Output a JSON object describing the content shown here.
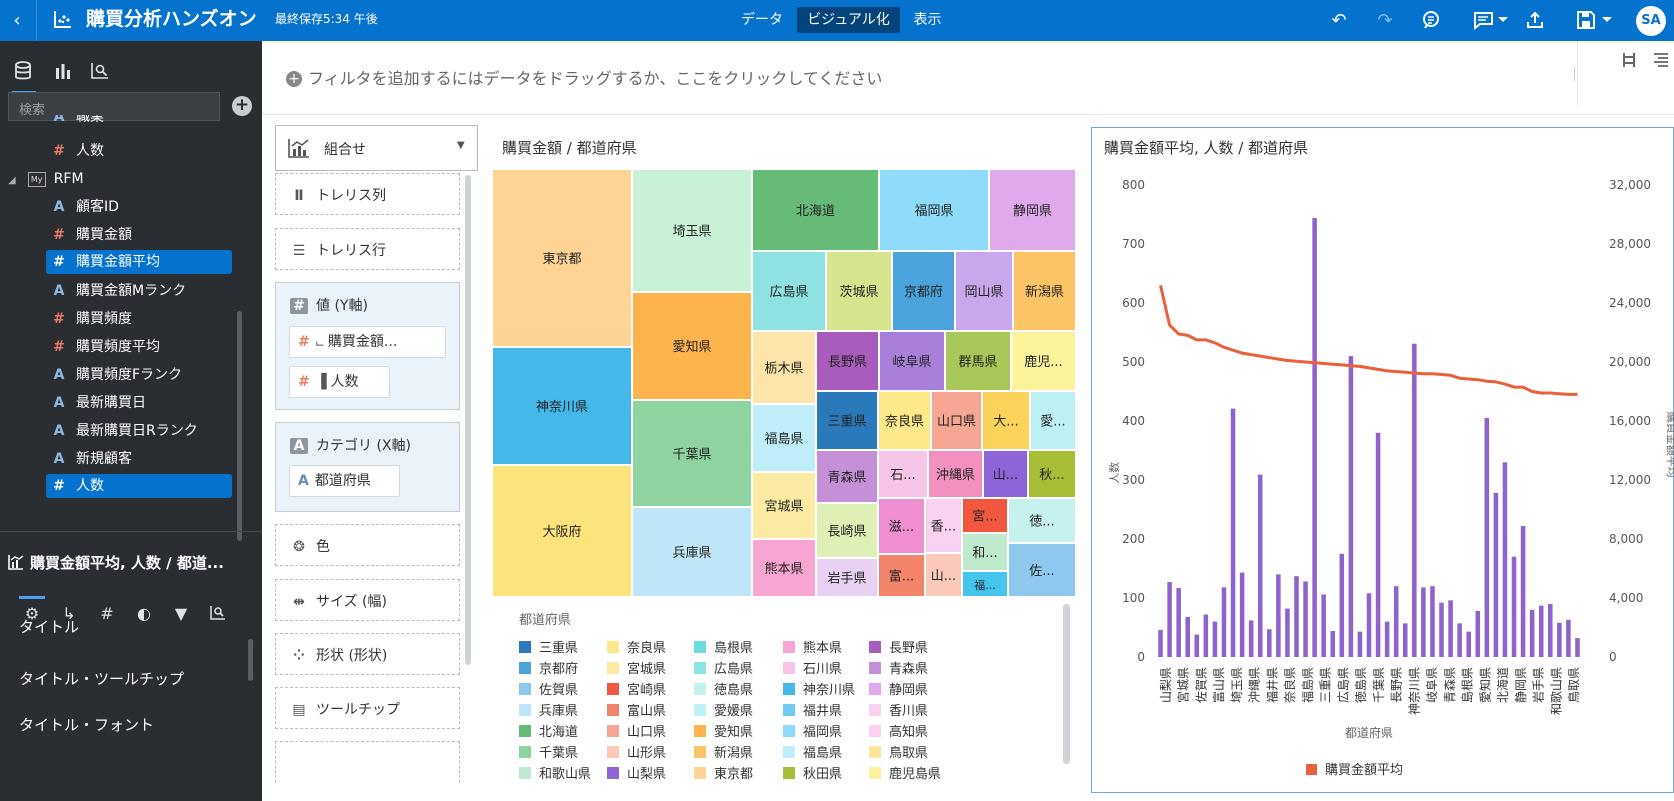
{
  "app": {
    "title": "購買分析ハンズオン",
    "save_status": "最終保存5:34 午後",
    "tabs": [
      {
        "label": "データ",
        "active": false
      },
      {
        "label": "ビジュアル化",
        "active": true
      },
      {
        "label": "表示",
        "active": false
      }
    ],
    "user_initials": "SA",
    "accent_color": "#0572ce"
  },
  "left_panel": {
    "search_placeholder": "検索",
    "tree": [
      {
        "label": "職業",
        "type": "text",
        "partial": true
      },
      {
        "label": "人数",
        "type": "number"
      },
      {
        "label": "RFM",
        "type": "folder"
      },
      {
        "label": "顧客ID",
        "type": "text"
      },
      {
        "label": "購買金額",
        "type": "number"
      },
      {
        "label": "購買金額平均",
        "type": "number",
        "selected": true
      },
      {
        "label": "購買金額Mランク",
        "type": "text"
      },
      {
        "label": "購買頻度",
        "type": "number"
      },
      {
        "label": "購買頻度平均",
        "type": "number"
      },
      {
        "label": "購買頻度Fランク",
        "type": "text"
      },
      {
        "label": "最新購買日",
        "type": "text"
      },
      {
        "label": "最新購買日Rランク",
        "type": "text"
      },
      {
        "label": "新規顧客",
        "type": "text"
      },
      {
        "label": "人数",
        "type": "number",
        "selected": true
      }
    ],
    "properties_title": "購買金額平均, 人数 / 都道...",
    "properties": [
      "タイトル",
      "タイトル・ツールチップ",
      "タイトル・フォント"
    ]
  },
  "filter_bar": {
    "placeholder": "フィルタを追加するにはデータをドラッグするか、ここをクリックしてください"
  },
  "grammar": {
    "chart_type": "組合せ",
    "trellis_columns": "トレリス列",
    "trellis_rows": "トレリス行",
    "values_label": "値 (Y軸)",
    "values_pills": [
      "購買金額...",
      "人数"
    ],
    "category_label": "カテゴリ (X軸)",
    "category_pills": [
      "都道府県"
    ],
    "color": "色",
    "size": "サイズ (幅)",
    "shape": "形状 (形状)",
    "tooltip": "ツールチップ"
  },
  "treemap": {
    "title": "購買金額 / 都道府県",
    "legend_title": "都道府県",
    "cells": [
      {
        "label": "東京都",
        "color": "#fdd494"
      },
      {
        "label": "神奈川県",
        "color": "#45b8ea"
      },
      {
        "label": "大阪府",
        "color": "#fde37c"
      },
      {
        "label": "埼玉県",
        "color": "#c9f1d5"
      },
      {
        "label": "愛知県",
        "color": "#fdb44d"
      },
      {
        "label": "千葉県",
        "color": "#8fd4a0"
      },
      {
        "label": "兵庫県",
        "color": "#bfe5f9"
      },
      {
        "label": "北海道",
        "color": "#66bb77"
      },
      {
        "label": "福岡県",
        "color": "#8edcf9"
      },
      {
        "label": "静岡県",
        "color": "#dfa9eb"
      },
      {
        "label": "広島県",
        "color": "#8fe2e2"
      },
      {
        "label": "茨城県",
        "color": "#d6e48d"
      },
      {
        "label": "京都府",
        "color": "#4ba3dc"
      },
      {
        "label": "岡山県",
        "color": "#c8a8ea"
      },
      {
        "label": "新潟県",
        "color": "#fdc465"
      },
      {
        "label": "栃木県",
        "color": "#fde4ab"
      },
      {
        "label": "長野県",
        "color": "#a85cbe"
      },
      {
        "label": "岐阜県",
        "color": "#a880dc"
      },
      {
        "label": "群馬県",
        "color": "#a9c85a"
      },
      {
        "label": "鹿児...",
        "color": "#fbf39b"
      },
      {
        "label": "福島県",
        "color": "#bfeef9"
      },
      {
        "label": "三重県",
        "color": "#2a7abb"
      },
      {
        "label": "奈良県",
        "color": "#fde98a"
      },
      {
        "label": "山口県",
        "color": "#f7a693"
      },
      {
        "label": "大...",
        "color": "#fbd35a"
      },
      {
        "label": "愛...",
        "color": "#bdf1f6"
      },
      {
        "label": "宮城県",
        "color": "#fbeaa2"
      },
      {
        "label": "青森県",
        "color": "#c690d8"
      },
      {
        "label": "石...",
        "color": "#f6c5e8"
      },
      {
        "label": "沖縄県",
        "color": "#f290c0"
      },
      {
        "label": "山...",
        "color": "#8e65d8"
      },
      {
        "label": "秋...",
        "color": "#a7be36"
      },
      {
        "label": "長崎県",
        "color": "#def0b6"
      },
      {
        "label": "滋...",
        "color": "#ef8ed0"
      },
      {
        "label": "香...",
        "color": "#f9d2f1"
      },
      {
        "label": "宮...",
        "color": "#f0573e"
      },
      {
        "label": "熊本県",
        "color": "#f8a5d2"
      },
      {
        "label": "岩手県",
        "color": "#e9d1f3"
      },
      {
        "label": "富...",
        "color": "#f3836a"
      },
      {
        "label": "山...",
        "color": "#fbc9b9"
      },
      {
        "label": "和...",
        "color": "#bfe9cc"
      },
      {
        "label": "徳...",
        "color": "#c5f1ee"
      },
      {
        "label": "福...",
        "color": "#45c4ed"
      },
      {
        "label": "佐...",
        "color": "#8ec8ef"
      }
    ],
    "legend": [
      {
        "label": "三重県",
        "color": "#2a7abb"
      },
      {
        "label": "奈良県",
        "color": "#fde98a"
      },
      {
        "label": "島根県",
        "color": "#6ddcdc"
      },
      {
        "label": "熊本県",
        "color": "#f8a5d2"
      },
      {
        "label": "長野県",
        "color": "#a85cbe"
      },
      {
        "label": "京都府",
        "color": "#4ba3dc"
      },
      {
        "label": "宮城県",
        "color": "#fbeaa2"
      },
      {
        "label": "広島県",
        "color": "#8fe2e2"
      },
      {
        "label": "石川県",
        "color": "#f6c5e8"
      },
      {
        "label": "青森県",
        "color": "#c690d8"
      },
      {
        "label": "佐賀県",
        "color": "#8ec8ef"
      },
      {
        "label": "宮崎県",
        "color": "#f0573e"
      },
      {
        "label": "徳島県",
        "color": "#c5f1ee"
      },
      {
        "label": "神奈川県",
        "color": "#45b8ea"
      },
      {
        "label": "静岡県",
        "color": "#dfa9eb"
      },
      {
        "label": "兵庫県",
        "color": "#bfe5f9"
      },
      {
        "label": "富山県",
        "color": "#f3836a"
      },
      {
        "label": "愛媛県",
        "color": "#bdf1f6"
      },
      {
        "label": "福井県",
        "color": "#6ccbef"
      },
      {
        "label": "香川県",
        "color": "#f9d2f1"
      },
      {
        "label": "北海道",
        "color": "#66bb77"
      },
      {
        "label": "山口県",
        "color": "#f7a693"
      },
      {
        "label": "愛知県",
        "color": "#fdb44d"
      },
      {
        "label": "福岡県",
        "color": "#8edcf9"
      },
      {
        "label": "高知県",
        "color": "#fbd1ee"
      },
      {
        "label": "千葉県",
        "color": "#8fd4a0"
      },
      {
        "label": "山形県",
        "color": "#fbc9b9"
      },
      {
        "label": "新潟県",
        "color": "#fdc465"
      },
      {
        "label": "福島県",
        "color": "#bfeef9"
      },
      {
        "label": "鳥取県",
        "color": "#fbe79a"
      },
      {
        "label": "和歌山県",
        "color": "#bfe9cc"
      },
      {
        "label": "山梨県",
        "color": "#8e65d8"
      },
      {
        "label": "東京都",
        "color": "#fdd494"
      },
      {
        "label": "秋田県",
        "color": "#a7be36"
      },
      {
        "label": "鹿児島県",
        "color": "#fbf39b"
      }
    ]
  },
  "chart_data": {
    "type": "bar",
    "title": "購買金額平均, 人数 / 都道府県",
    "xlabel": "都道府県",
    "ylabel": "人数",
    "y2label": "購買金額平均",
    "ylim": [
      0,
      800
    ],
    "y2lim": [
      0,
      32000
    ],
    "yticks": [
      0,
      100,
      200,
      300,
      400,
      500,
      600,
      700,
      800
    ],
    "y2ticks": [
      "0",
      "4,000",
      "8,000",
      "12,000",
      "16,000",
      "20,000",
      "24,000",
      "28,000",
      "32,000"
    ],
    "categories": [
      "山梨県",
      "宮城県",
      "佐賀県",
      "富山県",
      "埼玉県",
      "沖縄県",
      "福井県",
      "奈良県",
      "福島県",
      "三重県",
      "広島県",
      "徳島県",
      "千葉県",
      "長野県",
      "神奈川県",
      "岐阜県",
      "青森県",
      "島根県",
      "愛知県",
      "北海道",
      "静岡県",
      "岩手県",
      "和歌山県",
      "鳥取県"
    ],
    "series": [
      {
        "name": "人数",
        "kind": "bar",
        "color": "#8f63cc",
        "values": [
          46,
          127,
          117,
          68,
          38,
          72,
          60,
          118,
          421,
          143,
          62,
          309,
          47,
          140,
          82,
          137,
          128,
          744,
          106,
          44,
          175,
          510,
          43,
          108,
          380,
          60,
          120,
          57,
          531,
          118,
          120,
          92,
          96,
          57,
          43,
          78,
          405,
          278,
          330,
          170,
          222,
          80,
          87,
          90,
          58,
          63,
          32
        ]
      },
      {
        "name": "購買金額平均",
        "kind": "line",
        "color": "#e8613c",
        "values": [
          25200,
          22500,
          21900,
          21800,
          21500,
          21500,
          21300,
          21000,
          20800,
          20600,
          20500,
          20400,
          20300,
          20200,
          20100,
          20050,
          20000,
          19950,
          19900,
          19850,
          19800,
          19750,
          19700,
          19600,
          19500,
          19400,
          19350,
          19300,
          19250,
          19200,
          19200,
          19150,
          19100,
          18900,
          18850,
          18800,
          18700,
          18650,
          18500,
          18300,
          18300,
          18000,
          17900,
          17900,
          17850,
          17800,
          17800
        ]
      }
    ],
    "legend": [
      {
        "label": "購買金額平均",
        "color": "#e8613c"
      }
    ]
  }
}
